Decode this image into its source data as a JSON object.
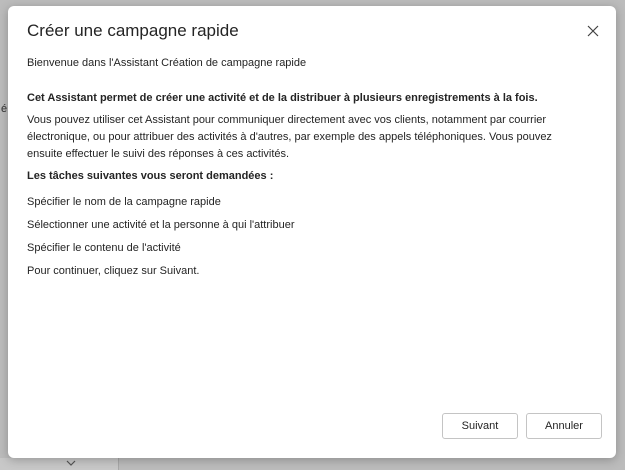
{
  "background": {
    "fragment_text": "é"
  },
  "dialog": {
    "title": "Créer une campagne rapide",
    "close_icon": "close-icon",
    "welcome": "Bienvenue dans l'Assistant Création de campagne rapide",
    "intro": "Cet Assistant permet de créer une activité et de la distribuer à plusieurs enregistrements à la fois.",
    "description": "Vous pouvez utiliser cet Assistant pour communiquer directement avec vos clients, notamment par courrier électronique, ou pour attribuer des activités à d'autres, par exemple des appels téléphoniques. Vous pouvez ensuite effectuer le suivi des réponses à ces activités.",
    "tasks_heading": "Les tâches suivantes vous seront demandées :",
    "tasks": [
      "Spécifier le nom de la campagne rapide",
      "Sélectionner une activité et la personne à qui l'attribuer",
      "Spécifier le contenu de l'activité",
      "Pour continuer, cliquez sur Suivant."
    ],
    "buttons": {
      "next": "Suivant",
      "cancel": "Annuler"
    }
  },
  "colors": {
    "backdrop": "#bcbcbc",
    "dialog_bg": "#ffffff",
    "text": "#242424",
    "button_border": "#c4c4c4"
  }
}
